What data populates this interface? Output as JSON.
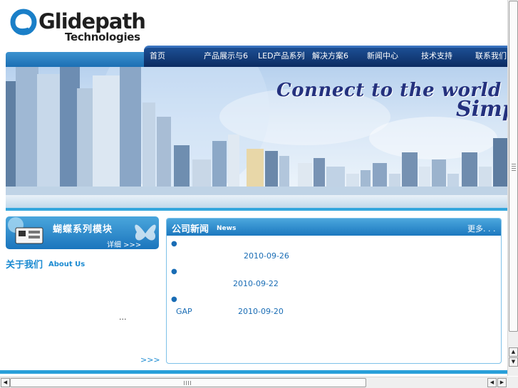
{
  "logo": {
    "name": "Glidepath",
    "subtitle": "Technologies",
    "brand_color": "#1a7fc8"
  },
  "nav": {
    "items": [
      {
        "label": "首页"
      },
      {
        "label": "产品展示与6"
      },
      {
        "label": "LED产品系列"
      },
      {
        "label": "解决方案6"
      },
      {
        "label": "新闻中心"
      },
      {
        "label": "技术支持"
      },
      {
        "label": "联系我们"
      }
    ],
    "bg_color": "#0c2c62"
  },
  "banner": {
    "slogan_line1": "Connect to the world",
    "slogan_line2": "Simp"
  },
  "promo": {
    "title": "蝴蝶系列模块",
    "more_label": "详细 >>>"
  },
  "about": {
    "title_cn": "关于我们",
    "title_en": "About Us",
    "ellipsis": "...",
    "more_label": ">>>"
  },
  "news": {
    "title_cn": "公司新闻",
    "title_en": "News",
    "more_label": "更多. . .",
    "items": [
      {
        "bullet": "●",
        "text": "",
        "date": "2010-09-26"
      },
      {
        "bullet": "●",
        "text": "",
        "date": "2010-09-22"
      },
      {
        "bullet": "●",
        "text": "GAP",
        "date": "2010-09-20"
      }
    ],
    "accent_color": "#1c78bf"
  },
  "scrollbars": {
    "vertical": {
      "up_icon": "▲",
      "down_icon": "▼"
    },
    "horizontal": {
      "left_icon": "◀",
      "right_icon": "▶"
    }
  }
}
